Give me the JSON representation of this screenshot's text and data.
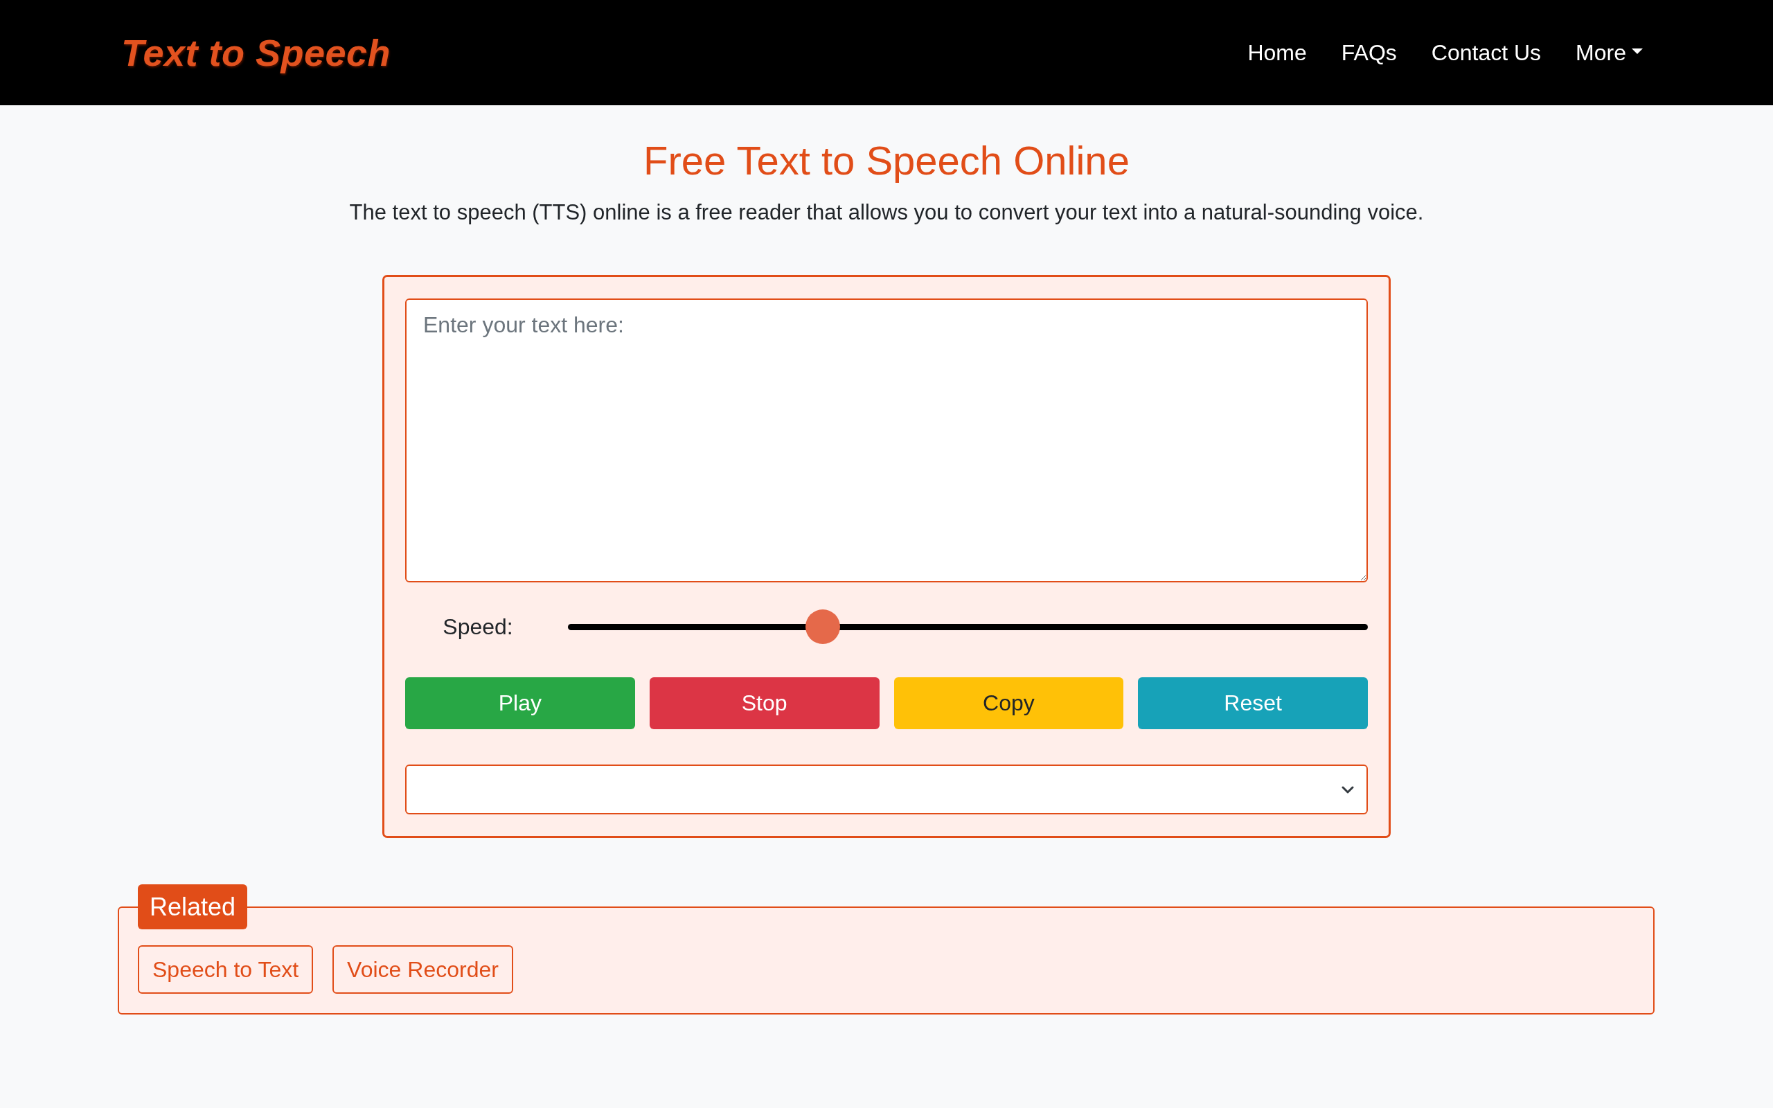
{
  "header": {
    "logo": "Text to Speech",
    "nav": [
      {
        "label": "Home",
        "kind": "link"
      },
      {
        "label": "FAQs",
        "kind": "link"
      },
      {
        "label": "Contact Us",
        "kind": "link"
      },
      {
        "label": "More",
        "kind": "dropdown"
      }
    ]
  },
  "hero": {
    "title": "Free Text to Speech Online",
    "subtitle": "The text to speech (TTS) online is a free reader that allows you to convert your text into a natural-sounding voice."
  },
  "editor": {
    "text_input": {
      "placeholder": "Enter your text here:"
    },
    "speed": {
      "label": "Speed:",
      "level": 0.31
    },
    "buttons": [
      {
        "label": "Play",
        "color": "#28a745"
      },
      {
        "label": "Stop",
        "color": "#dc3545"
      },
      {
        "label": "Copy",
        "color": "#ffc107"
      },
      {
        "label": "Reset",
        "color": "#17a2b8"
      }
    ]
  },
  "related": {
    "legend": "Related",
    "links": [
      "Speech to Text",
      "Voice Recorder"
    ]
  }
}
